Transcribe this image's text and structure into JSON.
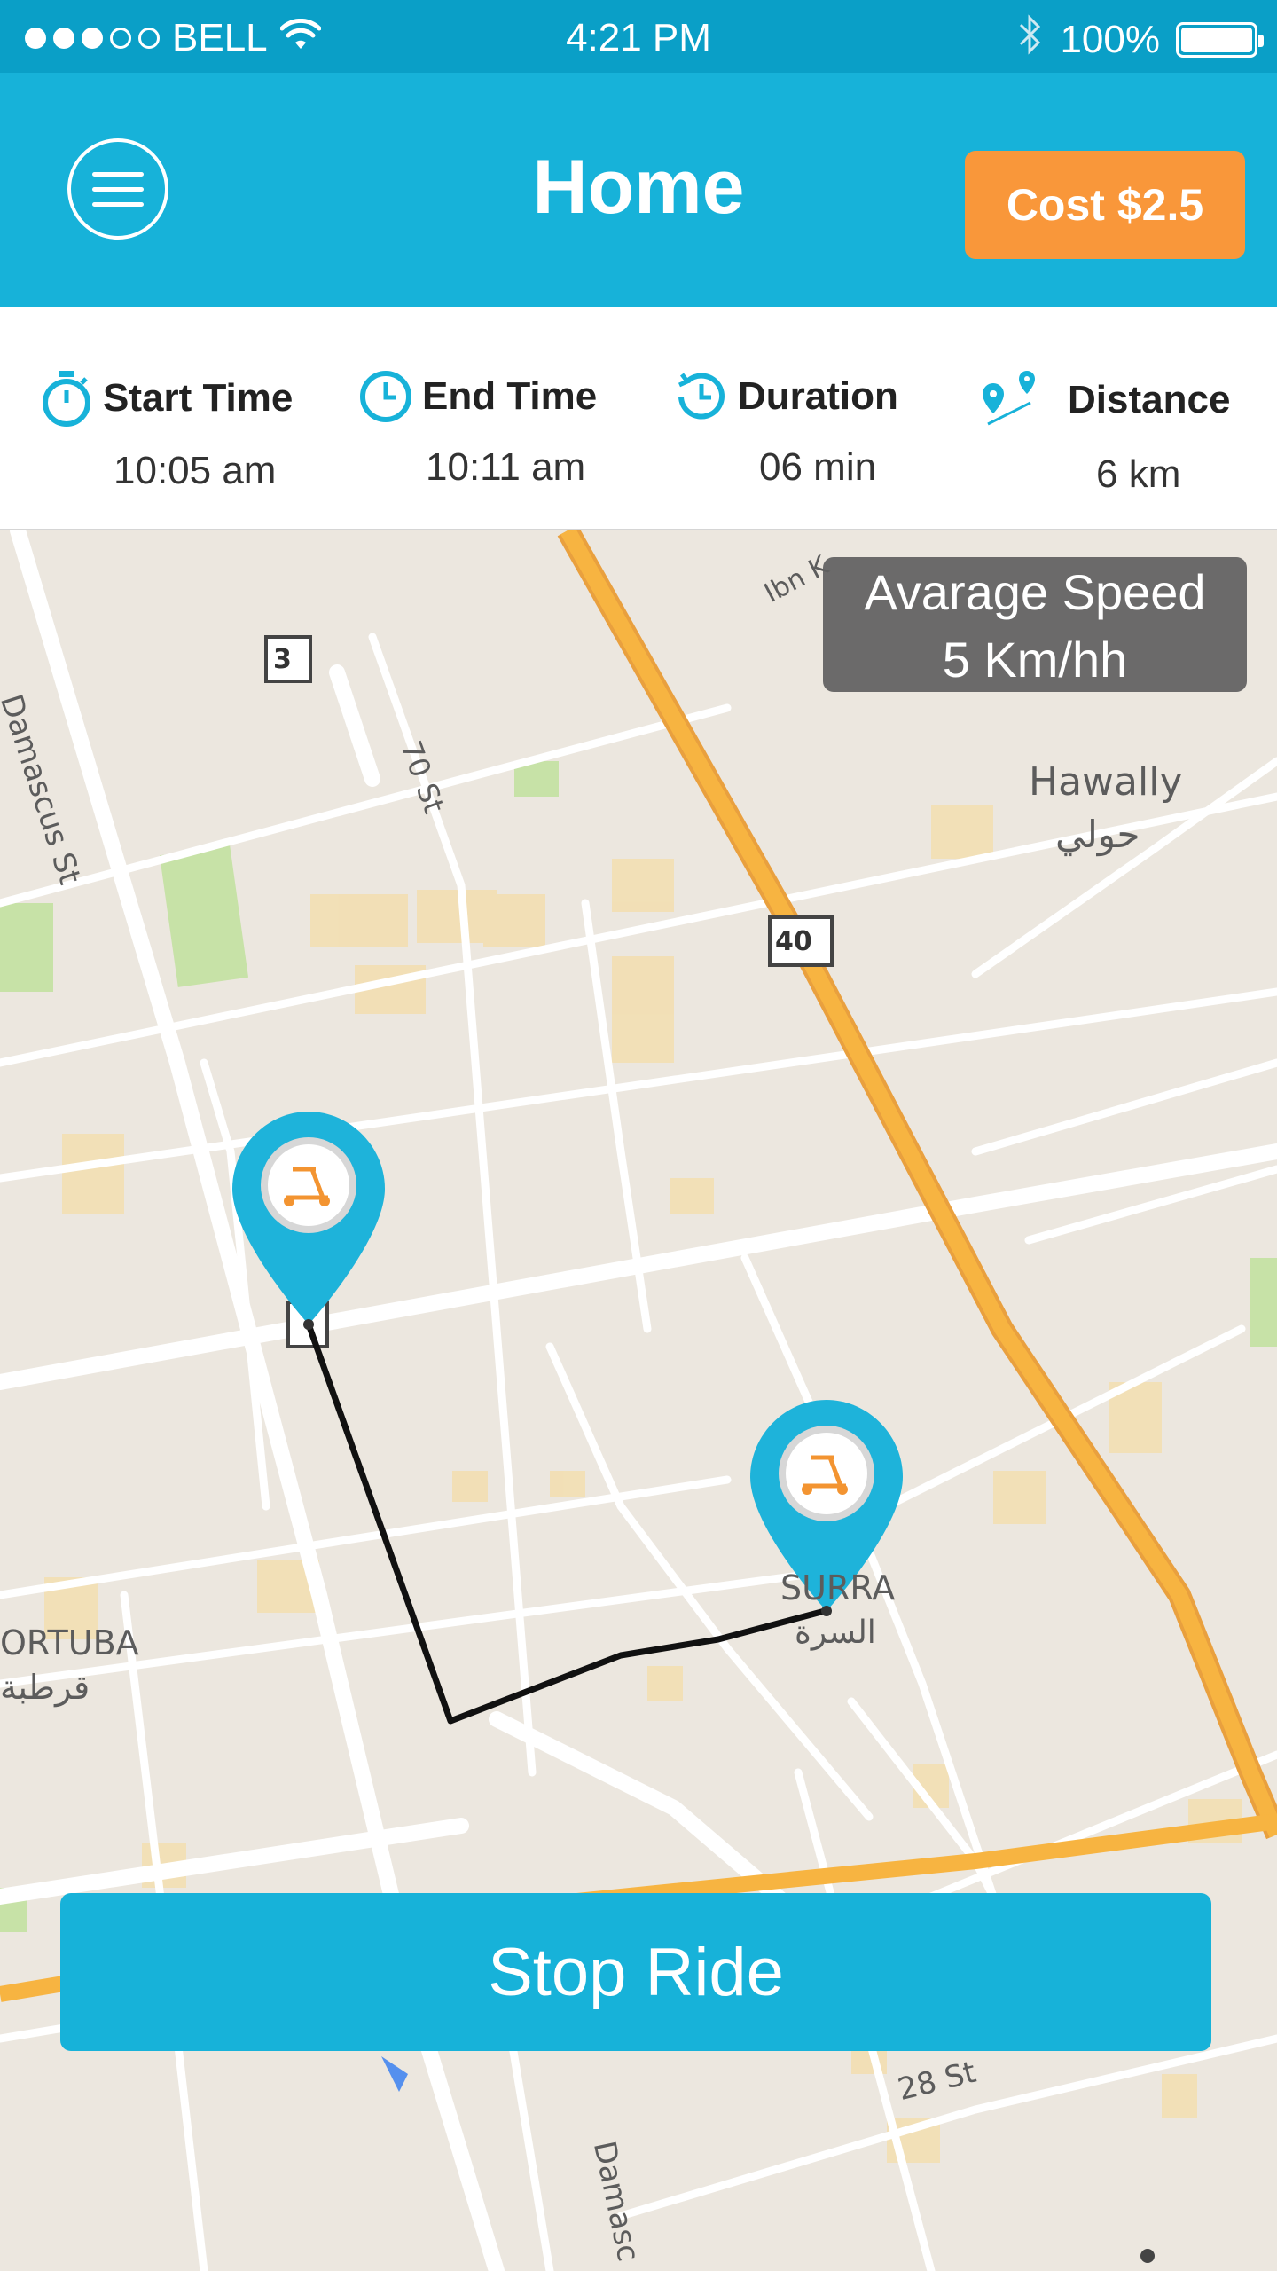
{
  "status_bar": {
    "carrier": "BELL",
    "time": "4:21 PM",
    "battery": "100%",
    "signal_bars_filled": 3,
    "signal_bars_total": 5
  },
  "header": {
    "title": "Home",
    "cost_label": "Cost $2.5"
  },
  "stats": [
    {
      "label": "Start Time",
      "value": "10:05 am",
      "icon": "stopwatch-icon"
    },
    {
      "label": "End Time",
      "value": "10:11 am",
      "icon": "clock-icon"
    },
    {
      "label": "Duration",
      "value": "06 min",
      "icon": "history-clock-icon"
    },
    {
      "label": "Distance",
      "value": "6 km",
      "icon": "route-pins-icon"
    }
  ],
  "map": {
    "average_speed_title": "Avarage Speed",
    "average_speed_value": "5 Km/hh",
    "labels": {
      "area_hawally": "Hawally",
      "area_hawally_ar": "حولي",
      "area_qurtuba": "ORTUBA",
      "area_qurtuba_ar": "قرطبة",
      "area_surra": "SURRA",
      "area_surra_ar": "السرة",
      "street_damascus": "Damascus St",
      "street_damascus_bottom": "Damasc",
      "street_70": "70 St",
      "street_28": "28 St",
      "street_ibn": "Ibn K",
      "route_3": "3",
      "route_40": "40"
    }
  },
  "actions": {
    "stop_ride": "Stop Ride"
  },
  "colors": {
    "primary": "#17b2d9",
    "accent": "#f9973a",
    "status_bar": "#0a9fc7",
    "highway": "#f5a623"
  }
}
